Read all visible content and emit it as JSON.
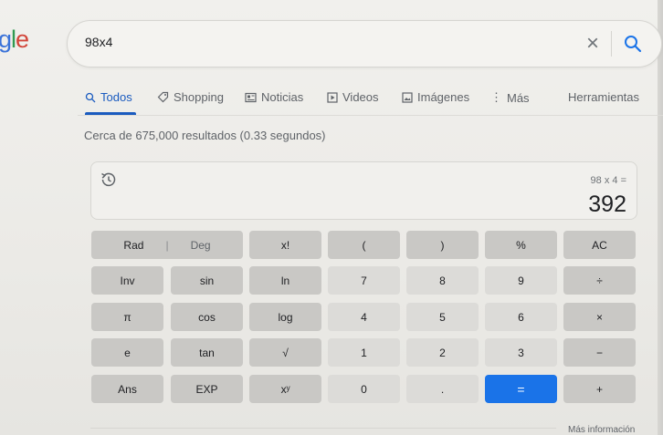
{
  "logo": {
    "text_g": "g",
    "text_l": "l",
    "text_e": "e"
  },
  "search": {
    "query": "98x4"
  },
  "tabs": [
    {
      "label": "Todos",
      "icon": "search-icon",
      "active": true
    },
    {
      "label": "Shopping",
      "icon": "tag-icon",
      "active": false
    },
    {
      "label": "Noticias",
      "icon": "newspaper-icon",
      "active": false
    },
    {
      "label": "Videos",
      "icon": "play-icon",
      "active": false
    },
    {
      "label": "Imágenes",
      "icon": "image-icon",
      "active": false
    },
    {
      "label": "Más",
      "icon": "more-vert-icon",
      "active": false
    },
    {
      "label": "Herramientas",
      "icon": "",
      "active": false
    }
  ],
  "results_stats": "Cerca de 675,000 resultados (0.33 segundos)",
  "calculator": {
    "expression": "98 x 4 =",
    "result": "392",
    "rows": [
      [
        "Rad | Deg",
        "x!",
        "(",
        ")",
        "%",
        "AC"
      ],
      [
        "Inv",
        "sin",
        "ln",
        "7",
        "8",
        "9",
        "÷"
      ],
      [
        "π",
        "cos",
        "log",
        "4",
        "5",
        "6",
        "×"
      ],
      [
        "e",
        "tan",
        "√",
        "1",
        "2",
        "3",
        "−"
      ],
      [
        "Ans",
        "EXP",
        "xʸ",
        "0",
        ".",
        "=",
        "+"
      ]
    ],
    "keys": {
      "rad": "Rad",
      "deg": "Deg",
      "fact": "x!",
      "lparen": "(",
      "rparen": ")",
      "pct": "%",
      "ac": "AC",
      "inv": "Inv",
      "sin": "sin",
      "ln": "ln",
      "k7": "7",
      "k8": "8",
      "k9": "9",
      "div": "÷",
      "pi": "π",
      "cos": "cos",
      "log": "log",
      "k4": "4",
      "k5": "5",
      "k6": "6",
      "mul": "×",
      "e": "e",
      "tan": "tan",
      "sqrt": "√",
      "k1": "1",
      "k2": "2",
      "k3": "3",
      "sub": "−",
      "ans": "Ans",
      "exp": "EXP",
      "pow": "xʸ",
      "k0": "0",
      "dot": ".",
      "eq": "=",
      "add": "+"
    }
  },
  "footer": {
    "more_info": "Más información"
  },
  "colors": {
    "accent": "#1a73e8",
    "tab_active": "#1a5bbf",
    "logo_blue": "#3b73d9"
  }
}
